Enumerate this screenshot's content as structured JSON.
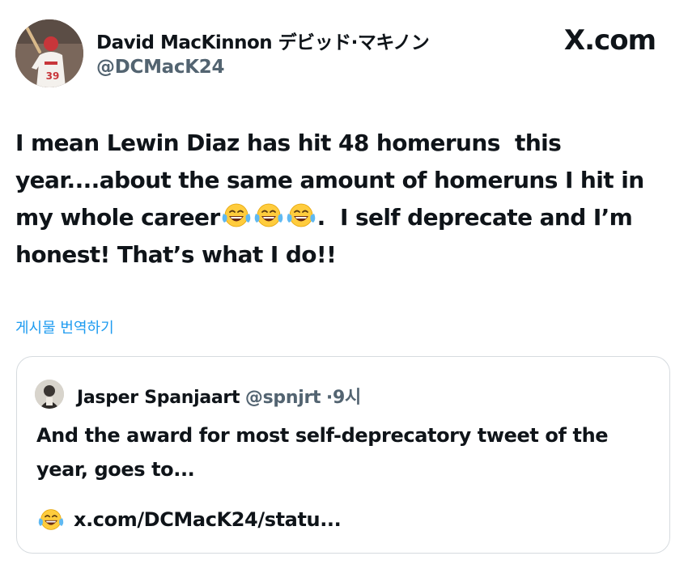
{
  "brand": {
    "label": "X.com"
  },
  "author": {
    "name": "David MacKinnon デビッド·マキノン",
    "handle": "@DCMacK24",
    "jersey_number": "39"
  },
  "tweet": {
    "line1": "I mean Lewin Diaz has hit 48 homeruns  this",
    "line2": "year....about the same amount of homeruns I hit in",
    "line3a": "my whole career",
    "line3b": ".  I self deprecate and I’m",
    "line4": "honest! That’s what I do!!"
  },
  "translate_label": "게시물 번역하기",
  "quote": {
    "name": "Jasper Spanjaart",
    "handle": "@spnjrt",
    "separator": "·",
    "time": "9시",
    "text": "And the award for most self-deprecatory tweet of the year, goes to...",
    "link": "x.com/DCMacK24/statu..."
  },
  "icons": {
    "emoji": "face-with-tears-of-joy-icon",
    "brand": "x-logo-icon"
  },
  "colors": {
    "link_blue": "#1d9bf0",
    "secondary_text": "#536471",
    "border": "#d6dbdf"
  }
}
